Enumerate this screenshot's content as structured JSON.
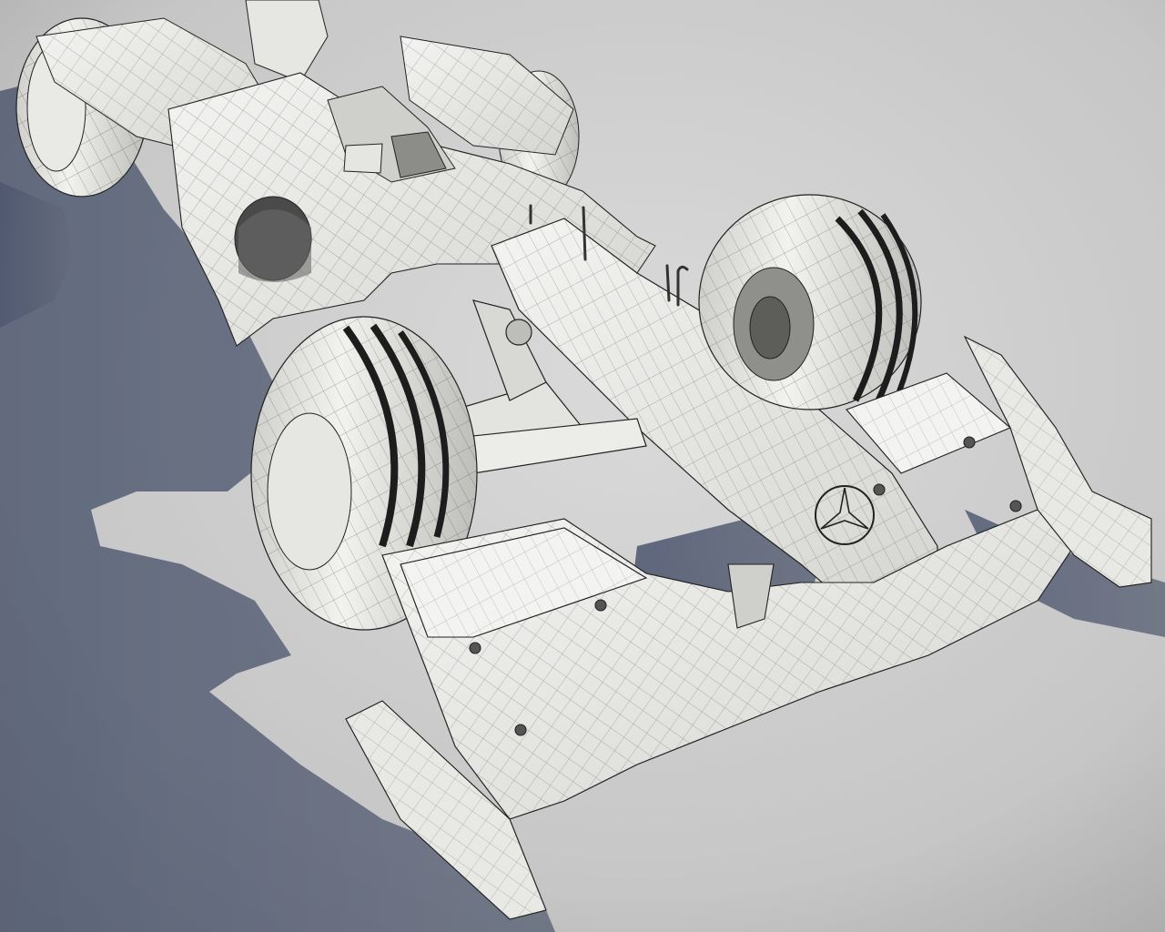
{
  "scene": {
    "subject": "formula-one-car-wireframe-render",
    "colors": {
      "ground_light": "#d6d6d6",
      "ground_dark": "#a9a9a9",
      "shadow": "#4b5566",
      "shadow_far": "#6e7685",
      "body_light": "#f2f2f0",
      "body_mid": "#d9d9d6",
      "body_dark": "#9c9c98",
      "wire": "#2a2a2a"
    },
    "icons": [
      "three-pointed-star-emblem"
    ]
  }
}
